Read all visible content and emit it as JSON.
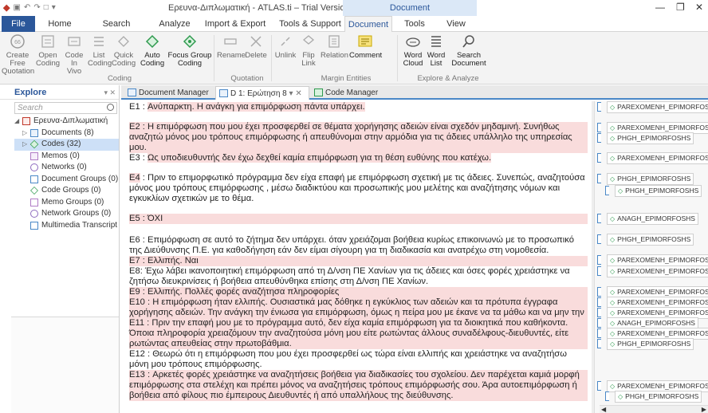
{
  "titlebar": {
    "title": "Ερευνα-Διπλωματική - ATLAS.ti – Trial Version",
    "context_tab": "Document",
    "minimize": "—",
    "restore": "❐",
    "close": "✕"
  },
  "tabs": [
    "File",
    "Home",
    "Search Project",
    "Analyze",
    "Import & Export",
    "Tools & Support",
    "Document",
    "Tools",
    "View"
  ],
  "ribbon": {
    "buttons": [
      {
        "label": "Create Free\nQuotation",
        "icon": "quote-icon"
      },
      {
        "label": "Open\nCoding",
        "icon": "open-coding-icon"
      },
      {
        "label": "Code In\nVivo",
        "icon": "in-vivo-icon"
      },
      {
        "label": "List\nCoding",
        "icon": "list-coding-icon"
      },
      {
        "label": "Quick\nCoding",
        "icon": "quick-coding-icon"
      },
      {
        "label": "Auto\nCoding",
        "icon": "auto-coding-icon"
      },
      {
        "label": "Focus Group\nCoding",
        "icon": "focus-group-icon"
      },
      {
        "label": "Rename",
        "icon": "rename-icon"
      },
      {
        "label": "Delete",
        "icon": "delete-icon"
      },
      {
        "label": "Unlink",
        "icon": "unlink-icon"
      },
      {
        "label": "Flip\nLink",
        "icon": "flip-link-icon"
      },
      {
        "label": "Relation",
        "icon": "relation-icon"
      },
      {
        "label": "Comment",
        "icon": "comment-icon"
      },
      {
        "label": "Word\nCloud",
        "icon": "word-cloud-icon"
      },
      {
        "label": "Word\nList",
        "icon": "word-list-icon"
      },
      {
        "label": "Search\nDocument",
        "icon": "search-document-icon"
      }
    ],
    "groups": [
      "Coding",
      "Quotation",
      "Margin Entities",
      "Explore & Analyze"
    ]
  },
  "explore": {
    "title": "Explore",
    "search_placeholder": "Search",
    "tree": [
      {
        "label": "Ερευνα-Διπλωματική",
        "icon": "project-icon"
      },
      {
        "label": "Documents (8)",
        "icon": "documents-icon"
      },
      {
        "label": "Codes (32)",
        "icon": "codes-icon"
      },
      {
        "label": "Memos (0)",
        "icon": "memos-icon"
      },
      {
        "label": "Networks (0)",
        "icon": "networks-icon"
      },
      {
        "label": "Document Groups (0)",
        "icon": "document-groups-icon"
      },
      {
        "label": "Code Groups (0)",
        "icon": "code-groups-icon"
      },
      {
        "label": "Memo Groups (0)",
        "icon": "memo-groups-icon"
      },
      {
        "label": "Network Groups (0)",
        "icon": "network-groups-icon"
      },
      {
        "label": "Multimedia Transcript",
        "icon": "multimedia-icon"
      }
    ]
  },
  "doc_tabs": [
    "Document Manager",
    "D 1: Ερώτηση 8",
    "Code Manager"
  ],
  "paragraphs": [
    {
      "id": "E1",
      "text": "Ανύπαρκτη. Η ανάγκη για επιμόρφωση πάντα υπάρχει."
    },
    {
      "id": "E2",
      "text": "Η επιμόρφωση που μου έχει προσφερθεί σε θέματα χορήγησης αδειών είναι σχεδόν μηδαμινή. Συνήθως αναζητώ μόνος μου τρόπους επιμόρφωσης ή απευθύνομαι στην αρμόδια για τις άδειες υπάλληλο της υπηρεσίας μου."
    },
    {
      "id": "E3",
      "text": "Ως υποδιευθυντής δεν έχω δεχθεί καμία επιμόρφωση για τη θέση ευθύνης που κατέχω."
    },
    {
      "id": "E4",
      "text": "Πριν το επιμορφωτικό πρόγραμμα δεν είχα επαφή με επιμόρφωση σχετική με τις άδειες. Συνεπώς, αναζητούσα μόνος μου τρόπους επιμόρφωσης , μέσω διαδικτύου και προσωπικής μου μελέτης και αναζήτησης νόμων και εγκυκλίων σχετικών με το θέμα."
    },
    {
      "id": "E5",
      "text": "ΌΧΙ"
    },
    {
      "id": "E6",
      "text": "Επιμόρφωση σε αυτό το ζήτημα δεν υπάρχει. όταν χρειάζομαι βοήθεια κυρίως επικοινωνώ με το προσωπικό της Διεύθυνσης Π.Ε. για καθοδήγηση εάν δεν είμαι σίγουρη για τη διαδικασία και ανατρέχω στη νομοθεσία."
    },
    {
      "id": "E7",
      "text": "Ελλιπής. Ναι"
    },
    {
      "id": "E8",
      "text": "Έχω λάβει ικανοποιητική επιμόρφωση από τη Δ/νση ΠΕ Χανίων για τις άδειες και όσες φορές χρειάστηκε να ζητήσω διευκρινίσεις ή βοήθεια απευθύνθηκα επίσης στη Δ/νση ΠΕ Χανίων."
    },
    {
      "id": "E9",
      "text": "Ελλιπής. Πολλές φορές αναζήτησα πληροφορίες"
    },
    {
      "id": "E10",
      "text": "Η επιμόρφωση ήταν ελλιπής. Ουσιαστικά μας δόθηκε η εγκύκλιος των αδειών και τα πρότυπα έγγραφα χορήγησης αδειών. Την ανάγκη την ένιωσα για επιμόρφωση, όμως η πείρα μου με έκανε να τα μάθω και να μην την αναζητήσω."
    },
    {
      "id": "E11",
      "text": "Πριν την επαφή μου με το πρόγραμμα αυτό, δεν είχα καμία επιμόρφωση για τα διοικητικά που καθήκοντα. Όποια πληροφορία χρειαζόμουν την αναζητούσα μόνη μου είτε ρωτώντας άλλους συναδέλφους-διευθυντές, είτε ρωτώντας απευθείας στην πρωτοβάθμια."
    },
    {
      "id": "E12",
      "text": "Θεωρώ ότι η επιμόρφωση που μου έχει προσφερθεί ως τώρα είναι ελλιπής και χρειάστηκε να αναζητήσω μόνη μου τρόπους επιμόρφωσης."
    },
    {
      "id": "E13",
      "text": "Αρκετές φορές χρειάστηκε να αναζητήσεις βοήθεια για διαδικασίες του σχολείου. Δεν παρέχεται καμιά μορφή επιμόρφωσης στα στελέχη και πρέπει μόνος να αναζητήσεις τρόπους επιμόρφωσής σου. Άρα αυτοεπιμόρφωση ή βοήθεια από φίλους πιο έμπειρους Διευθυντές ή από υπαλλήλους της διεύθυνσης."
    }
  ],
  "margin_codes": [
    "PAREXOMENH_EPIMORFOSH",
    "PAREXOMENH_EPIMORFOSH",
    "PHGH_EPIMORFOSHS",
    "PAREXOMENH_EPIMORFOSH",
    "PHGH_EPIMORFOSHS",
    "PHGH_EPIMORFOSHS",
    "ANAGH_EPIMORFOSHS",
    "PHGH_EPIMORFOSHS",
    "PAREXOMENH_EPIMORFOSH",
    "PAREXOMENH_EPIMORFOSH",
    "PAREXOMENH_EPIMORFOSH",
    "PAREXOMENH_EPIMORFOSH",
    "PAREXOMENH_EPIMORFOSH",
    "ANAGH_EPIMORFOSHS",
    "PAREXOMENH_EPIMORFOSH",
    "PHGH_EPIMORFOSHS",
    "PAREXOMENH_EPIMORFOSH",
    "PHGH_EPIMORFOSHS"
  ],
  "colors": {
    "accent": "#2b579a",
    "highlight": "#f9dcdc",
    "code_green": "#2e9a4e"
  }
}
